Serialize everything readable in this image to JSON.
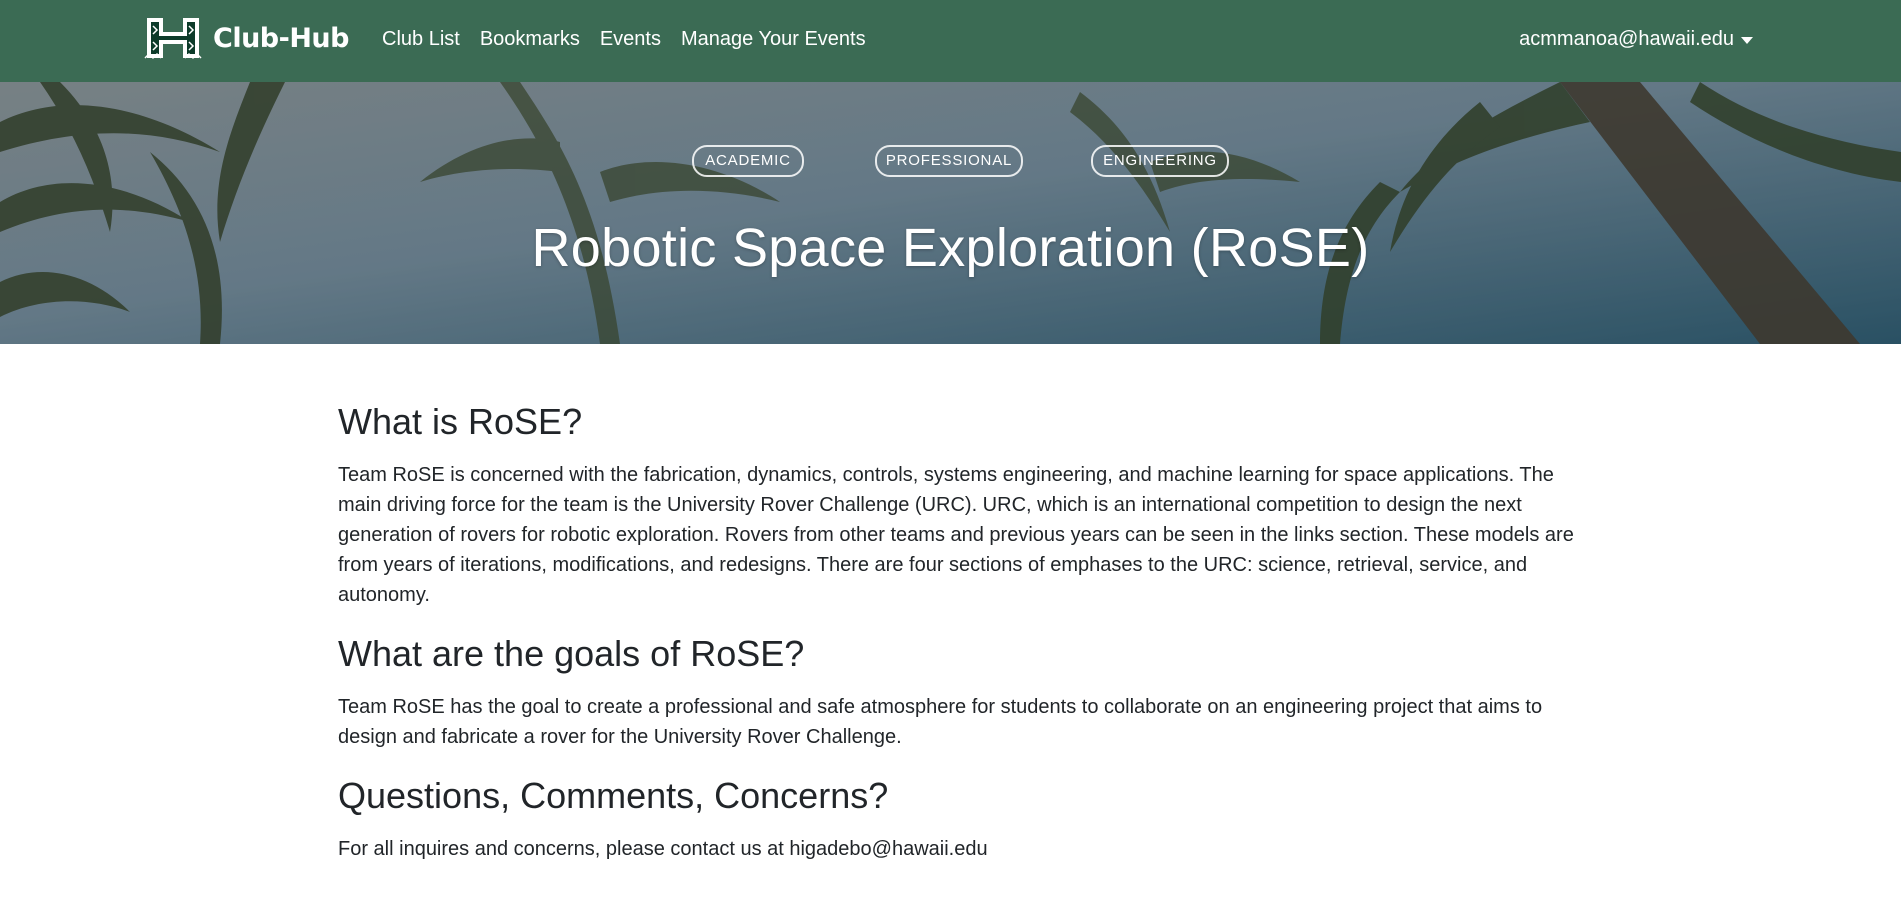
{
  "navbar": {
    "brand": "Club-Hub",
    "links": [
      "Club List",
      "Bookmarks",
      "Events",
      "Manage Your Events"
    ],
    "user_email": "acmmanoa@hawaii.edu",
    "colors": {
      "background": "#3b6b54",
      "text": "#ffffff"
    }
  },
  "hero": {
    "tags": [
      "ACADEMIC",
      "PROFESSIONAL",
      "ENGINEERING"
    ],
    "title": "Robotic Space Exploration (RoSE)"
  },
  "sections": [
    {
      "heading": "What is RoSE?",
      "body": "Team RoSE is concerned with the fabrication, dynamics, controls, systems engineering, and machine learning for space applications. The main driving force for the team is the University Rover Challenge (URC). URC, which is an international competition to design the next generation of rovers for robotic exploration. Rovers from other teams and previous years can be seen in the links section. These models are from years of iterations, modifications, and redesigns. There are four sections of emphases to the URC: science, retrieval, service, and autonomy."
    },
    {
      "heading": "What are the goals of RoSE?",
      "body": "Team RoSE has the goal to create a professional and safe atmosphere for students to collaborate on an engineering project that aims to design and fabricate a rover for the University Rover Challenge."
    },
    {
      "heading": "Questions, Comments, Concerns?",
      "body": "For all inquires and concerns, please contact us at higadebo@hawaii.edu"
    }
  ]
}
